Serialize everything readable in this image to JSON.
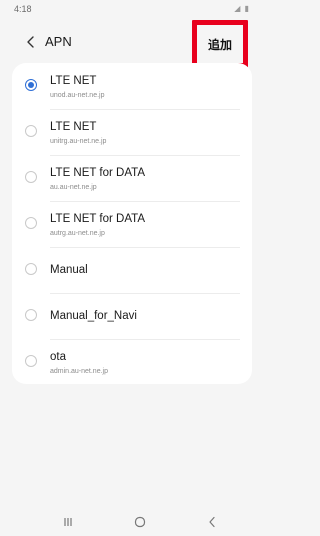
{
  "status_bar": {
    "time": "4:18",
    "icons": "◢ ▮"
  },
  "app_bar": {
    "title": "APN",
    "back_icon": "chevron-left",
    "add_label": "追加",
    "highlight_color": "#e8001d"
  },
  "apn_list": [
    {
      "name": "LTE NET",
      "apn": "unod.au-net.ne.jp",
      "selected": true
    },
    {
      "name": "LTE NET",
      "apn": "unitrg.au-net.ne.jp",
      "selected": false
    },
    {
      "name": "LTE NET for DATA",
      "apn": "au.au-net.ne.jp",
      "selected": false
    },
    {
      "name": "LTE NET for DATA",
      "apn": "autrg.au-net.ne.jp",
      "selected": false
    },
    {
      "name": "Manual",
      "apn": "",
      "selected": false
    },
    {
      "name": "Manual_for_Navi",
      "apn": "",
      "selected": false
    },
    {
      "name": "ota",
      "apn": "admin.au-net.ne.jp",
      "selected": false
    }
  ],
  "nav_bar": {
    "recents_icon": "recents-icon",
    "home_icon": "home-icon",
    "back_icon": "back-icon"
  },
  "colors": {
    "accent": "#2f6fd6",
    "background": "#f5f5f5",
    "card": "#ffffff"
  }
}
